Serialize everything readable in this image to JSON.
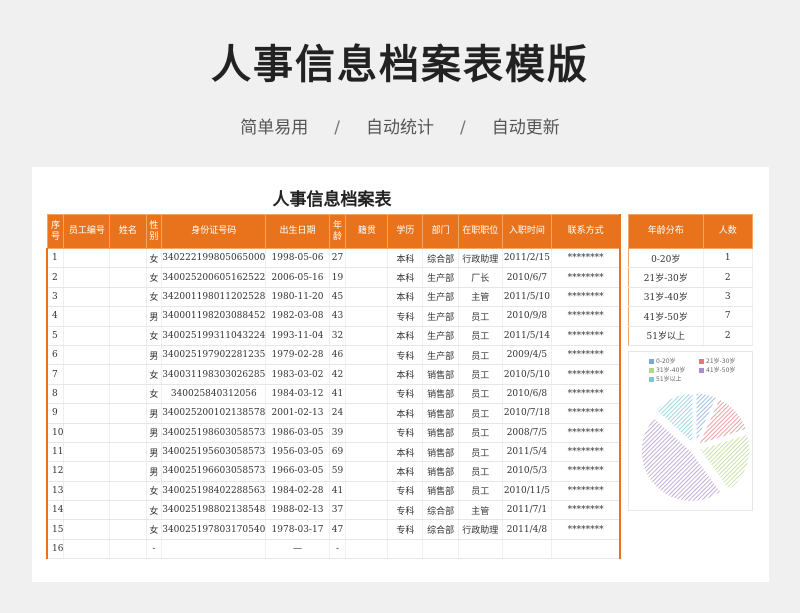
{
  "header": {
    "title": "人事信息档案表模版",
    "subtitle_items": [
      "简单易用",
      "自动统计",
      "自动更新"
    ],
    "separator": "/"
  },
  "sheet": {
    "title": "人事信息档案表",
    "columns": [
      "序号",
      "员工编号",
      "姓名",
      "性别",
      "身份证号码",
      "出生日期",
      "年龄",
      "籍贯",
      "学历",
      "部门",
      "在职职位",
      "入职时间",
      "联系方式"
    ],
    "rows": [
      [
        "1",
        "",
        "",
        "女",
        "340222199805065000",
        "1998-05-06",
        "27",
        "",
        "本科",
        "综合部",
        "行政助理",
        "2011/2/15",
        "********"
      ],
      [
        "2",
        "",
        "",
        "女",
        "340025200605162522",
        "2006-05-16",
        "19",
        "",
        "本科",
        "生产部",
        "厂长",
        "2010/6/7",
        "********"
      ],
      [
        "3",
        "",
        "",
        "女",
        "342001198011202528",
        "1980-11-20",
        "45",
        "",
        "本科",
        "生产部",
        "主管",
        "2011/5/10",
        "********"
      ],
      [
        "4",
        "",
        "",
        "男",
        "340001198203088452",
        "1982-03-08",
        "43",
        "",
        "专科",
        "生产部",
        "员工",
        "2010/9/8",
        "********"
      ],
      [
        "5",
        "",
        "",
        "女",
        "340025199311043224",
        "1993-11-04",
        "32",
        "",
        "本科",
        "生产部",
        "员工",
        "2011/5/14",
        "********"
      ],
      [
        "6",
        "",
        "",
        "男",
        "340025197902281235",
        "1979-02-28",
        "46",
        "",
        "专科",
        "生产部",
        "员工",
        "2009/4/5",
        "********"
      ],
      [
        "7",
        "",
        "",
        "女",
        "340031198303026285",
        "1983-03-02",
        "42",
        "",
        "本科",
        "销售部",
        "员工",
        "2010/5/10",
        "********"
      ],
      [
        "8",
        "",
        "",
        "女",
        "340025840312056",
        "1984-03-12",
        "41",
        "",
        "专科",
        "销售部",
        "员工",
        "2010/6/8",
        "********"
      ],
      [
        "9",
        "",
        "",
        "男",
        "340025200102138578",
        "2001-02-13",
        "24",
        "",
        "本科",
        "销售部",
        "员工",
        "2010/7/18",
        "********"
      ],
      [
        "10",
        "",
        "",
        "男",
        "340025198603058573",
        "1986-03-05",
        "39",
        "",
        "专科",
        "销售部",
        "员工",
        "2008/7/5",
        "********"
      ],
      [
        "11",
        "",
        "",
        "男",
        "340025195603058573",
        "1956-03-05",
        "69",
        "",
        "本科",
        "销售部",
        "员工",
        "2011/5/4",
        "********"
      ],
      [
        "12",
        "",
        "",
        "男",
        "340025196603058573",
        "1966-03-05",
        "59",
        "",
        "本科",
        "销售部",
        "员工",
        "2010/5/3",
        "********"
      ],
      [
        "13",
        "",
        "",
        "女",
        "340025198402288563",
        "1984-02-28",
        "41",
        "",
        "专科",
        "销售部",
        "员工",
        "2010/11/5",
        "********"
      ],
      [
        "14",
        "",
        "",
        "女",
        "340025198802138548",
        "1988-02-13",
        "37",
        "",
        "专科",
        "综合部",
        "主管",
        "2011/7/1",
        "********"
      ],
      [
        "15",
        "",
        "",
        "女",
        "340025197803170540",
        "1978-03-17",
        "47",
        "",
        "专科",
        "综合部",
        "行政助理",
        "2011/4/8",
        "********"
      ],
      [
        "16",
        "",
        "",
        "-",
        "",
        "—",
        "-",
        "",
        "",
        "",
        "",
        "",
        ""
      ]
    ]
  },
  "age_summary": {
    "columns": [
      "年龄分布",
      "人数"
    ],
    "rows": [
      [
        "0-20岁",
        "1"
      ],
      [
        "21岁-30岁",
        "2"
      ],
      [
        "31岁-40岁",
        "3"
      ],
      [
        "41岁-50岁",
        "7"
      ],
      [
        "51岁以上",
        "2"
      ]
    ]
  },
  "chart_data": {
    "type": "pie",
    "categories": [
      "0-20岁",
      "21岁-30岁",
      "31岁-40岁",
      "41岁-50岁",
      "51岁以上"
    ],
    "values": [
      1,
      2,
      3,
      7,
      2
    ],
    "colors": [
      "#7ba7d9",
      "#e07b7b",
      "#b5d68a",
      "#a98fc9",
      "#79c9d6"
    ],
    "legend": "top"
  }
}
